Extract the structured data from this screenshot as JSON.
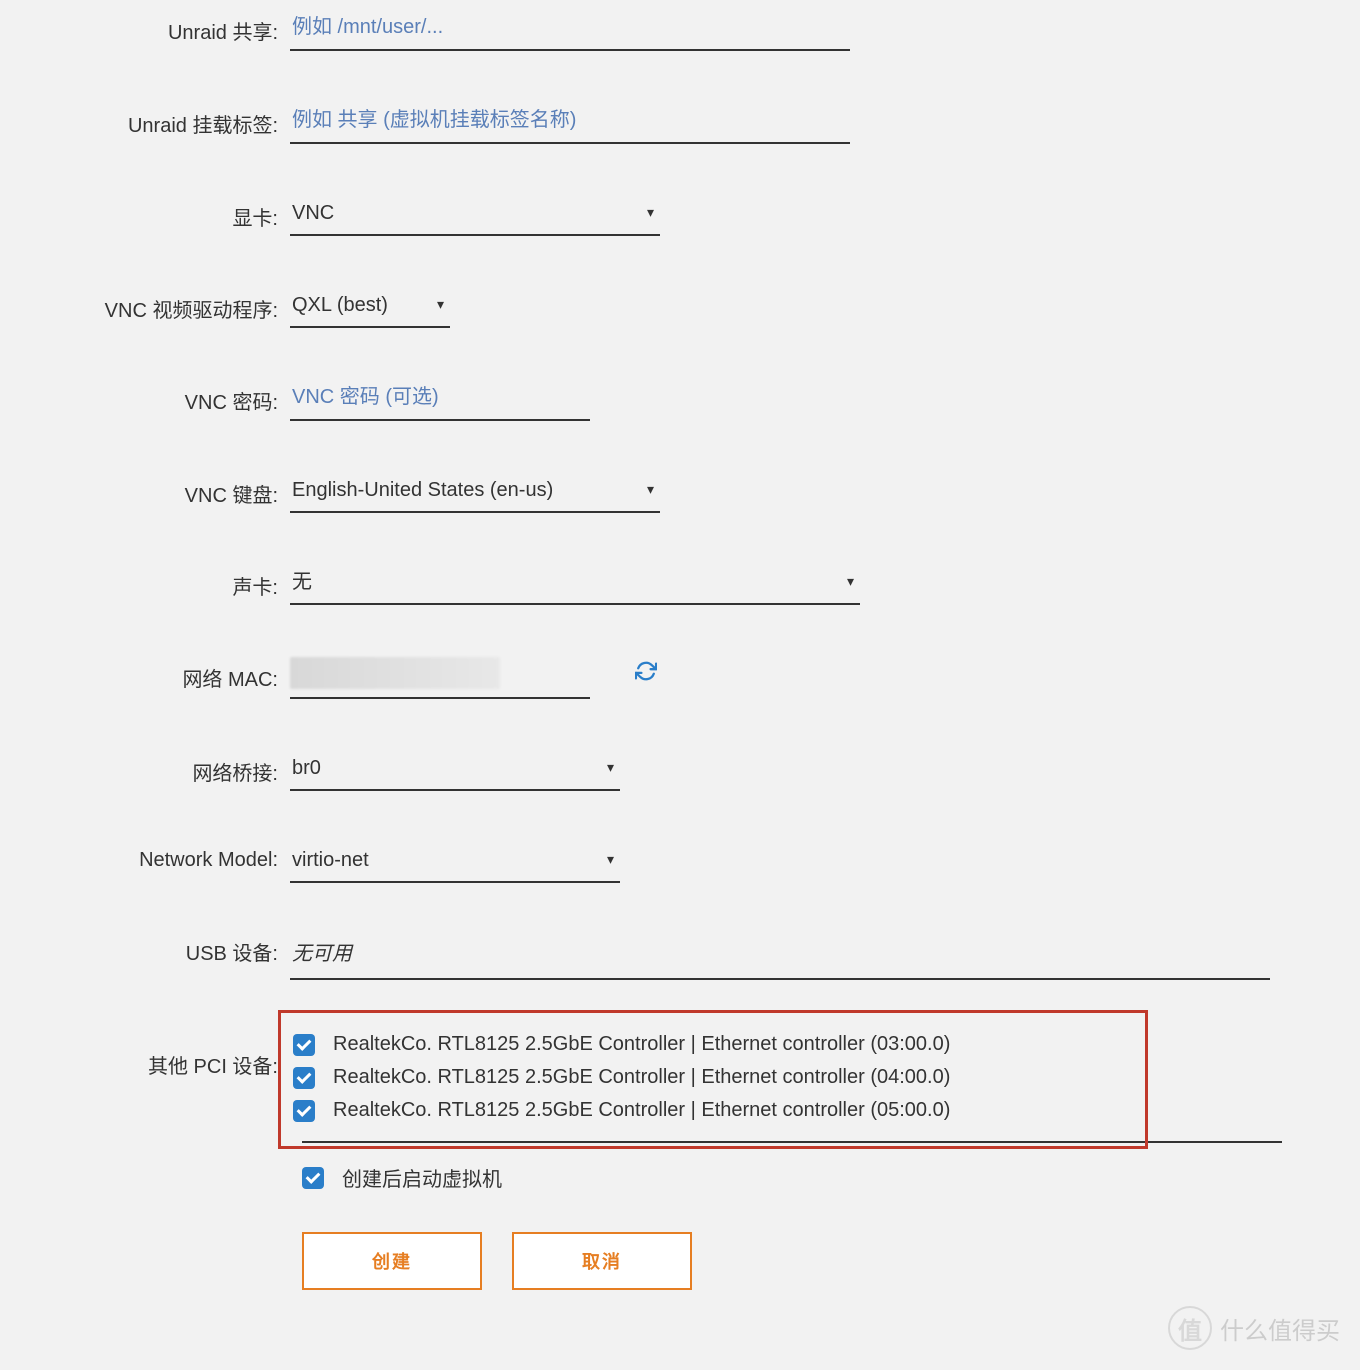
{
  "fields": {
    "unraid_share": {
      "label": "Unraid 共享:",
      "placeholder": "例如 /mnt/user/..."
    },
    "unraid_mount": {
      "label": "Unraid 挂载标签:",
      "placeholder": "例如 共享 (虚拟机挂载标签名称)"
    },
    "gpu": {
      "label": "显卡:",
      "value": "VNC"
    },
    "vnc_driver": {
      "label": "VNC 视频驱动程序:",
      "value": "QXL (best)"
    },
    "vnc_password": {
      "label": "VNC 密码:",
      "placeholder": "VNC 密码 (可选)"
    },
    "vnc_keyboard": {
      "label": "VNC 键盘:",
      "value": "English-United States (en-us)"
    },
    "sound": {
      "label": "声卡:",
      "value": "无"
    },
    "net_mac": {
      "label": "网络 MAC:"
    },
    "net_bridge": {
      "label": "网络桥接:",
      "value": "br0"
    },
    "net_model": {
      "label": "Network Model:",
      "value": "virtio-net"
    },
    "usb": {
      "label": "USB 设备:",
      "value": "无可用"
    },
    "pci": {
      "label": "其他 PCI 设备:",
      "items": [
        "RealtekCo. RTL8125 2.5GbE Controller | Ethernet controller (03:00.0)",
        "RealtekCo. RTL8125 2.5GbE Controller | Ethernet controller (04:00.0)",
        "RealtekCo. RTL8125 2.5GbE Controller | Ethernet controller (05:00.0)"
      ]
    },
    "start_after": "创建后启动虚拟机"
  },
  "buttons": {
    "create": "创建",
    "cancel": "取消"
  },
  "watermark": "什么值得买"
}
